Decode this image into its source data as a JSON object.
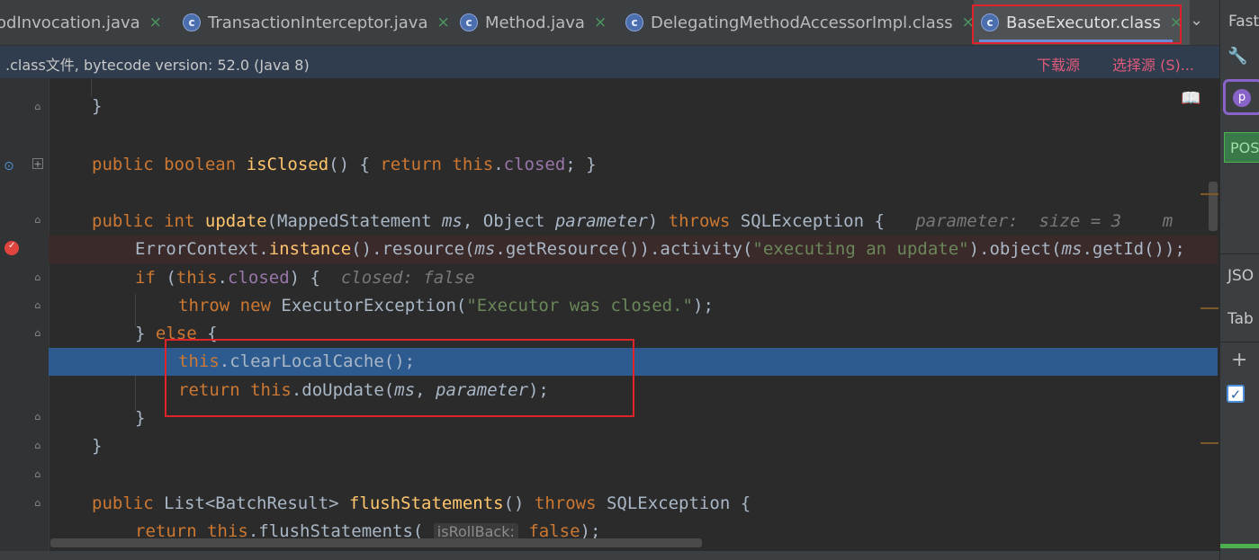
{
  "tabs": [
    {
      "label": "odInvocation.java",
      "icon": "class-icon"
    },
    {
      "label": "TransactionInterceptor.java",
      "icon": "class-icon"
    },
    {
      "label": "Method.java",
      "icon": "class-icon"
    },
    {
      "label": "DelegatingMethodAccessorImpl.class",
      "icon": "class-icon"
    },
    {
      "label": "BaseExecutor.class",
      "icon": "class-icon",
      "active": true
    }
  ],
  "close_glyph": "×",
  "tab_more": "⌄",
  "infobar": {
    "text": ".class文件, bytecode version: 52.0 (Java 8)",
    "download": "下载源",
    "choose": "选择源 (S)..."
  },
  "right_panel": {
    "fast": "Fast",
    "post": "POS",
    "json": "JSO",
    "table": "Tab",
    "p_label": "p"
  },
  "code": {
    "l1": "}",
    "l2_kw1": "public",
    "l2_kw2": "boolean",
    "l2_fn": "isClosed",
    "l2_a": "() { ",
    "l2_kw3": "return",
    "l2_kw4": "this",
    "l2_field": "closed",
    "l2_b": "; }",
    "l3_kw1": "public",
    "l3_kw2": "int",
    "l3_fn": "update",
    "l3_a": "(MappedStatement ",
    "l3_p1": "ms",
    "l3_b": ", Object ",
    "l3_p2": "parameter",
    "l3_c": ") ",
    "l3_kw3": "throws",
    "l3_d": " SQLException {",
    "l3_hint": "parameter:  size = 3    m",
    "l4_a": "ErrorContext.",
    "l4_m1": "instance",
    "l4_b": "().resource(",
    "l4_p1": "ms",
    "l4_c": ".getResource()).activity(",
    "l4_str": "\"executing an update\"",
    "l4_d": ").object(",
    "l4_p2": "ms",
    "l4_e": ".getId());",
    "l5_kw1": "if",
    "l5_a": " (",
    "l5_kw2": "this",
    "l5_field": "closed",
    "l5_b": ") {",
    "l5_hint": "closed: false",
    "l6_kw1": "throw",
    "l6_kw2": "new",
    "l6_a": " ExecutorException(",
    "l6_str": "\"Executor was closed.\"",
    "l6_b": ");",
    "l7_a": "} ",
    "l7_kw": "else",
    "l7_b": " {",
    "l8_kw": "this",
    "l8_a": ".clearLocalCache();",
    "l9_kw1": "return",
    "l9_kw2": "this",
    "l9_a": ".doUpdate(",
    "l9_p1": "ms",
    "l9_b": ", ",
    "l9_p2": "parameter",
    "l9_c": ");",
    "l10": "}",
    "l11": "}",
    "l12_kw1": "public",
    "l12_a": " List<BatchResult> ",
    "l12_fn": "flushStatements",
    "l12_b": "() ",
    "l12_kw2": "throws",
    "l12_c": " SQLException {",
    "l13_kw1": "return",
    "l13_kw2": "this",
    "l13_a": ".flushStatements(",
    "l13_inlay": "isRollBack:",
    "l13_kw3": "false",
    "l13_b": ");"
  }
}
